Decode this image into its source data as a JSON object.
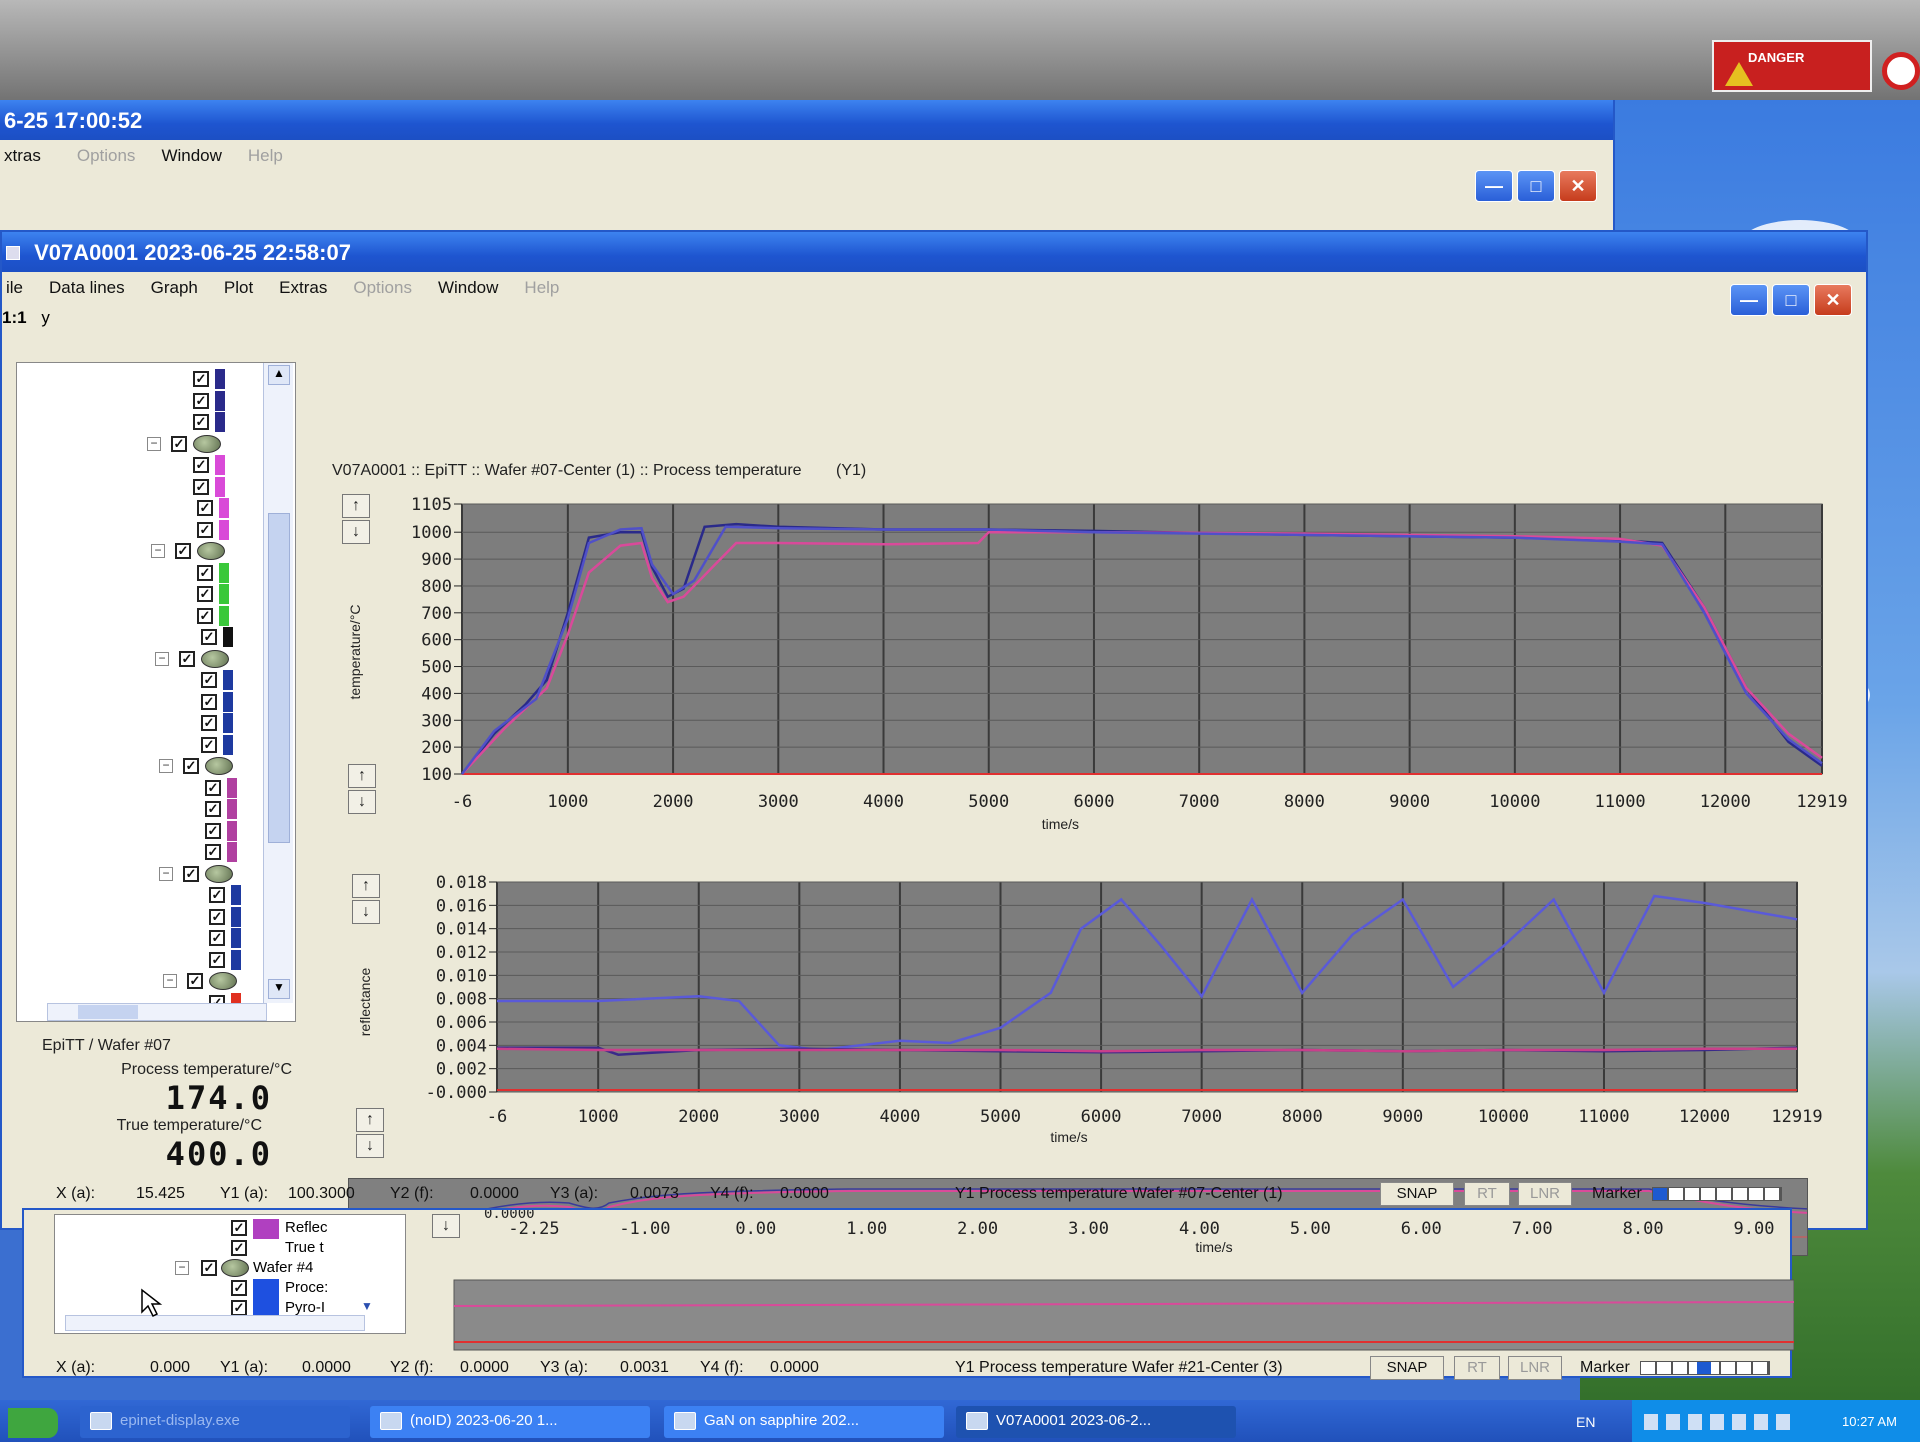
{
  "back_window": {
    "title": "6-25 17:00:52",
    "menu": [
      "xtras",
      "Options",
      "Window",
      "Help"
    ]
  },
  "sign": {
    "danger_label": "DANGER"
  },
  "main_window": {
    "title": "V07A0001 2023-06-25 22:58:07",
    "menu": [
      "ile",
      "Data lines",
      "Graph",
      "Plot",
      "Extras",
      "Options",
      "Window",
      "Help"
    ],
    "toolbar_scale": "1:1",
    "toolbar_axis": "y"
  },
  "chart_header": {
    "title": "V07A0001 :: EpiTT :: Wafer #07-Center (1) :: Process temperature",
    "axis_tag": "(Y1)"
  },
  "tree_panel": {
    "wafer_label": "EpiTT / Wafer #07",
    "process_temp_label": "Process temperature/°C",
    "process_temp_value": "174.0",
    "true_temp_label": "True temperature/°C",
    "true_temp_value": "400.0"
  },
  "status_bar": {
    "x_label": "X (a):",
    "x_value": "15.425",
    "y1_label": "Y1 (a):",
    "y1_value": "100.3000",
    "y2_label": "Y2 (f):",
    "y2_value": "0.0000",
    "y3_label": "Y3 (a):",
    "y3_value": "0.0073",
    "y4_label": "Y4 (f):",
    "y4_value": "0.0000",
    "series_label": "Y1  Process temperature Wafer #07-Center (1)",
    "snap": "SNAP",
    "rt": "RT",
    "lnr": "LNR",
    "marker": "Marker"
  },
  "lower_window": {
    "tree_items": [
      "Reflec",
      "True t",
      "Wafer #4",
      "Proce:",
      "Pyro-I"
    ],
    "x_ticks": [
      "-2.25",
      "-1.00",
      "0.00",
      "1.00",
      "2.00",
      "3.00",
      "4.00",
      "5.00",
      "6.00",
      "7.00",
      "8.00",
      "9.00"
    ],
    "x_top_partial": "0.0000",
    "xlabel": "time/s",
    "status": {
      "x_label": "X (a):",
      "x_value": "0.000",
      "y1_label": "Y1 (a):",
      "y1_value": "0.0000",
      "y2_label": "Y2 (f):",
      "y2_value": "0.0000",
      "y3_label": "Y3 (a):",
      "y3_value": "0.0031",
      "y4_label": "Y4 (f):",
      "y4_value": "0.0000",
      "series_label": "Y1  Process temperature Wafer #21-Center (3)",
      "snap": "SNAP",
      "rt": "RT",
      "lnr": "LNR",
      "marker": "Marker"
    }
  },
  "taskbar": {
    "items": [
      "epinet-display.exe",
      "(noID) 2023-06-20 1...",
      "GaN on sapphire 202...",
      "V07A0001 2023-06-2..."
    ],
    "tray_lang": "EN",
    "tray_time": "10:27 AM"
  },
  "chart_data": [
    {
      "type": "line",
      "ylabel": "temperature/°C",
      "xlabel": "time/s",
      "x_ticks": [
        "-6",
        "1000",
        "2000",
        "3000",
        "4000",
        "5000",
        "6000",
        "7000",
        "8000",
        "9000",
        "10000",
        "11000",
        "12000",
        "12919"
      ],
      "y_ticks": [
        "100",
        "200",
        "300",
        "400",
        "500",
        "600",
        "700",
        "800",
        "900",
        "1000",
        "1105"
      ],
      "xlim": [
        -6,
        12919
      ],
      "ylim": [
        100,
        1105
      ],
      "colors": [
        "#2a2a8a",
        "#d94a9a",
        "#5050c8"
      ],
      "series": [
        {
          "x": [
            -6,
            300,
            600,
            800,
            1000,
            1200,
            1500,
            1700,
            1800,
            1950,
            2100,
            2300,
            2600,
            3000,
            4000,
            4900,
            5000,
            6000,
            8000,
            10000,
            11000,
            11400,
            11800,
            12200,
            12600,
            12919
          ],
          "values": [
            100,
            250,
            360,
            450,
            700,
            980,
            1000,
            1000,
            870,
            760,
            790,
            1020,
            1030,
            1020,
            1010,
            1010,
            1010,
            1005,
            990,
            980,
            970,
            960,
            720,
            420,
            220,
            130
          ]
        },
        {
          "x": [
            -6,
            400,
            800,
            1000,
            1200,
            1500,
            1700,
            1800,
            1950,
            2100,
            2400,
            2600,
            3000,
            4000,
            4900,
            5000,
            6000,
            8000,
            10000,
            11000,
            11400,
            11800,
            12200,
            12600,
            12919
          ],
          "values": [
            100,
            270,
            420,
            620,
            850,
            950,
            960,
            830,
            740,
            760,
            880,
            960,
            960,
            955,
            960,
            1000,
            1000,
            995,
            985,
            975,
            950,
            720,
            420,
            250,
            160
          ]
        },
        {
          "x": [
            -6,
            300,
            700,
            1000,
            1200,
            1500,
            1700,
            1800,
            2000,
            2200,
            2500,
            3000,
            4000,
            5000,
            6000,
            8000,
            10000,
            11000,
            11400,
            11800,
            12200,
            12600,
            12919
          ],
          "values": [
            100,
            260,
            380,
            680,
            960,
            1010,
            1015,
            880,
            770,
            820,
            1020,
            1015,
            1010,
            1010,
            1000,
            990,
            980,
            965,
            955,
            700,
            400,
            230,
            140
          ]
        }
      ]
    },
    {
      "type": "line",
      "ylabel": "reflectance",
      "xlabel": "time/s",
      "x_ticks": [
        "-6",
        "1000",
        "2000",
        "3000",
        "4000",
        "5000",
        "6000",
        "7000",
        "8000",
        "9000",
        "10000",
        "11000",
        "12000",
        "12919"
      ],
      "y_ticks": [
        "-0.000",
        "0.002",
        "0.004",
        "0.006",
        "0.008",
        "0.010",
        "0.012",
        "0.014",
        "0.016",
        "0.018"
      ],
      "xlim": [
        -6,
        12919
      ],
      "ylim": [
        0,
        0.018
      ],
      "colors": [
        "#5a5ad8",
        "#3a2a8a",
        "#c8408a"
      ],
      "series": [
        {
          "x": [
            -6,
            1000,
            2000,
            2400,
            2800,
            3200,
            4000,
            4500,
            5000,
            5500,
            5800,
            6200,
            6600,
            7000,
            7500,
            8000,
            8500,
            9000,
            9500,
            10000,
            10500,
            11000,
            11500,
            12000,
            12919
          ],
          "values": [
            0.0078,
            0.0078,
            0.0082,
            0.0078,
            0.004,
            0.0036,
            0.0044,
            0.0042,
            0.0055,
            0.0085,
            0.014,
            0.0165,
            0.0125,
            0.0082,
            0.0165,
            0.0085,
            0.0135,
            0.0165,
            0.009,
            0.0125,
            0.0165,
            0.0085,
            0.0168,
            0.0162,
            0.0148
          ]
        },
        {
          "x": [
            -6,
            1000,
            1200,
            2000,
            3000,
            4000,
            5000,
            6000,
            7000,
            8000,
            9000,
            10000,
            11000,
            12000,
            12919
          ],
          "values": [
            0.0038,
            0.0038,
            0.0032,
            0.0036,
            0.0037,
            0.0036,
            0.0035,
            0.0034,
            0.0035,
            0.0036,
            0.0035,
            0.0036,
            0.0035,
            0.0036,
            0.0038
          ]
        },
        {
          "x": [
            -6,
            1000,
            2000,
            3000,
            4000,
            5000,
            6000,
            7000,
            8000,
            9000,
            10000,
            11000,
            12000,
            12919
          ],
          "values": [
            0.0037,
            0.0036,
            0.0036,
            0.0036,
            0.0036,
            0.0036,
            0.0035,
            0.0036,
            0.0036,
            0.0035,
            0.0036,
            0.0036,
            0.0037,
            0.0037
          ]
        }
      ]
    }
  ]
}
